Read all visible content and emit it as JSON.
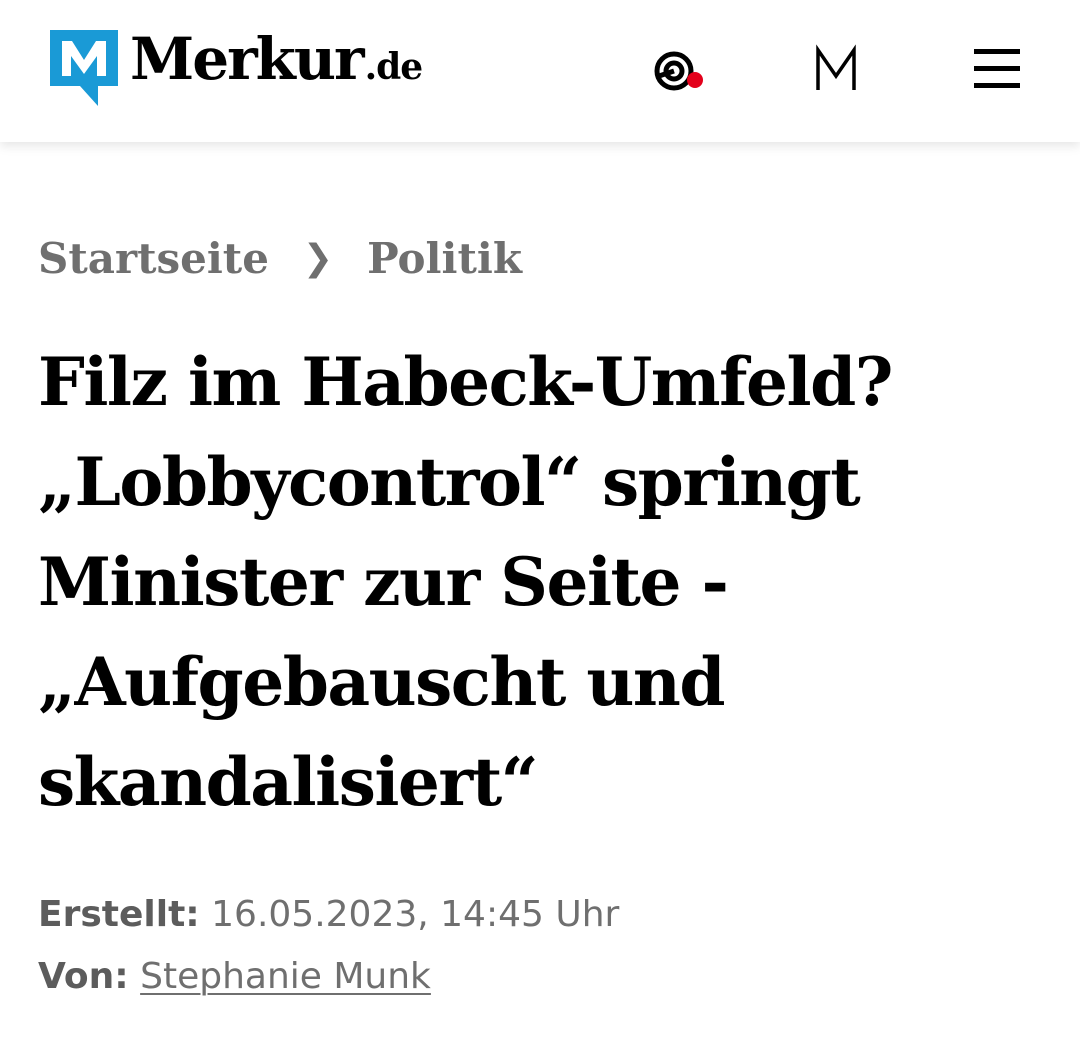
{
  "header": {
    "logo": {
      "name": "Merkur",
      "tld": ".de",
      "mark_color": "#1a9ad6",
      "icon": "merkur-logo-icon"
    },
    "icons": {
      "live": "live-notification-icon",
      "live_dot_color": "#e3001b",
      "m": "m-logo-icon",
      "menu": "hamburger-menu-icon"
    }
  },
  "breadcrumb": {
    "items": [
      "Startseite",
      "Politik"
    ],
    "separator": "❯"
  },
  "article": {
    "headline_lines": [
      "Filz im Habeck-Umfeld?",
      "„Lobbycontrol“ springt",
      "Minister zur Seite -",
      "„Aufgebauscht und",
      "skandalisiert“"
    ],
    "created_label": "Erstellt:",
    "created_value": "16.05.2023, 14:45 Uhr",
    "author_label": "Von:",
    "author_name": "Stephanie Munk"
  },
  "colors": {
    "meta_text": "#6f6f6f",
    "headline": "#000000",
    "background": "#ffffff"
  }
}
